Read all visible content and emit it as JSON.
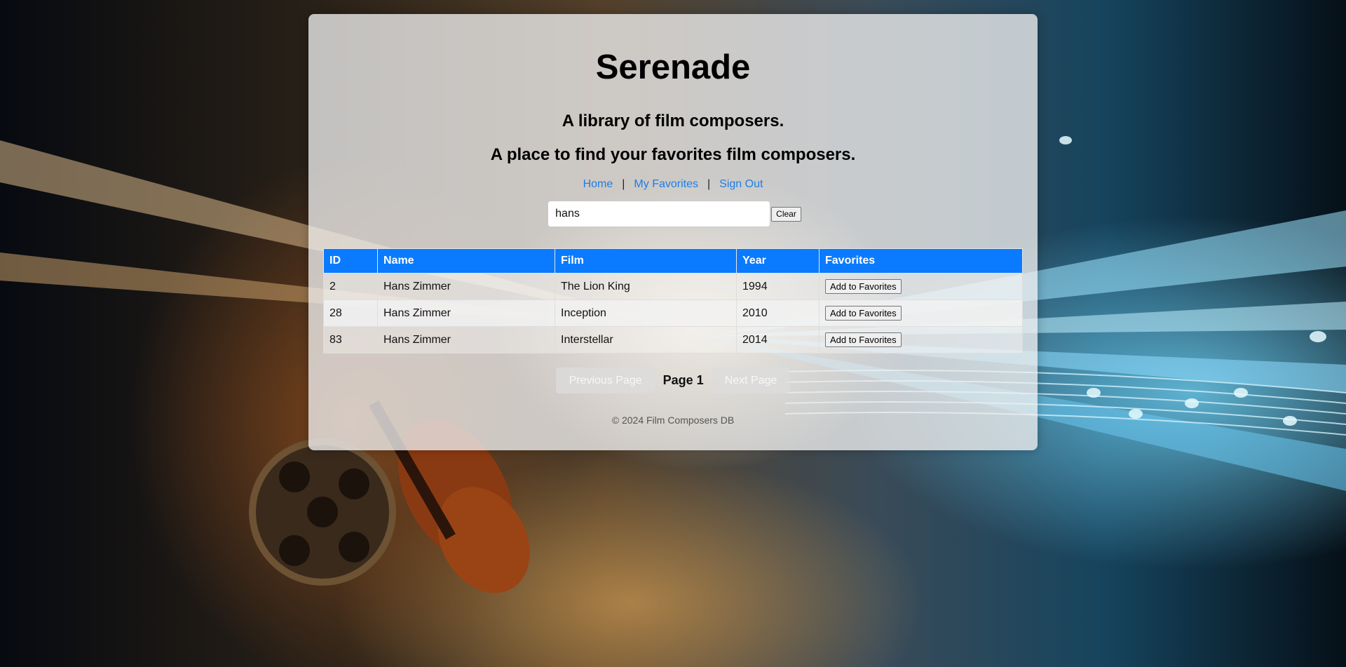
{
  "page": {
    "title": "Serenade",
    "subtitle_1": "A library of film composers.",
    "subtitle_2": "A place to find your favorites film composers."
  },
  "nav": {
    "home": "Home",
    "favorites": "My Favorites",
    "signout": "Sign Out",
    "separator": "|"
  },
  "search": {
    "value": "hans",
    "clear_label": "Clear"
  },
  "table": {
    "headers": [
      "ID",
      "Name",
      "Film",
      "Year",
      "Favorites"
    ],
    "rows": [
      {
        "id": "2",
        "name": "Hans Zimmer",
        "film": "The Lion King",
        "year": "1994",
        "action": "Add to Favorites"
      },
      {
        "id": "28",
        "name": "Hans Zimmer",
        "film": "Inception",
        "year": "2010",
        "action": "Add to Favorites"
      },
      {
        "id": "83",
        "name": "Hans Zimmer",
        "film": "Interstellar",
        "year": "2014",
        "action": "Add to Favorites"
      }
    ]
  },
  "pager": {
    "prev_label": "Previous Page",
    "page_label": "Page 1",
    "next_label": "Next Page"
  },
  "footer": {
    "text": "© 2024 Film Composers DB"
  },
  "theme": {
    "accent": "#0a7bff",
    "link": "#1e7de6"
  }
}
